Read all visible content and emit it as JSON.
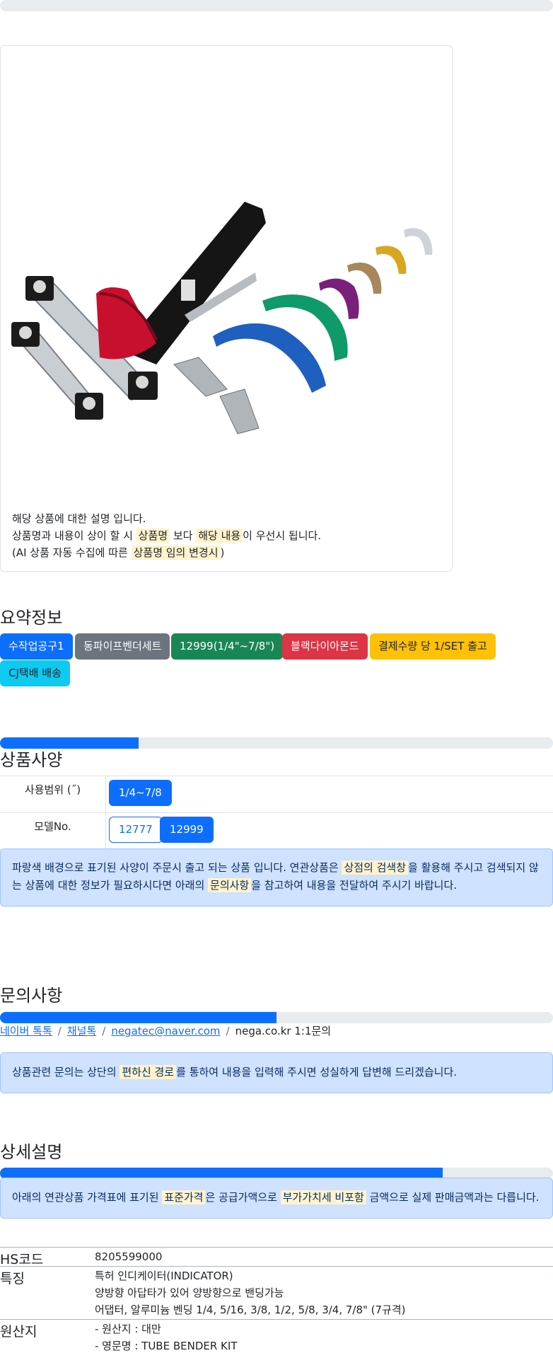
{
  "card": {
    "desc_line1": "해당 상품에 대한 설명 입니다.",
    "desc_line2_a": "상품명과 내용이 상이 할 시 ",
    "desc_line2_hl1": "상품명",
    "desc_line2_b": " 보다 ",
    "desc_line2_hl2": "해당 내용",
    "desc_line2_c": "이 우선시 됩니다.",
    "desc_line3_a": "(AI 상품 자동 수집에 따른 ",
    "desc_line3_hl": "상품명 임의 변경시",
    "desc_line3_b": ")"
  },
  "summary": {
    "title": "요약정보",
    "badges": [
      {
        "label": "수작업공구1",
        "color": "#0d6efd"
      },
      {
        "label": "동파이프벤더세트",
        "color": "#6c757d"
      },
      {
        "label": "12999(1/4\"~7/8\")",
        "color": "#198754"
      },
      {
        "label": "블랙다이아몬드",
        "color": "#dc3545"
      },
      {
        "label": "결제수량 당 1/SET 출고",
        "color": "#ffc107"
      },
      {
        "label": "CJ택배 배송",
        "color": "#0dcaf0"
      }
    ]
  },
  "specs": {
    "title": "상품사양",
    "progress": 0.25,
    "rows": [
      {
        "label": "사용범위 (˝)",
        "options": [
          {
            "label": "1/4~7/8",
            "selected": true
          }
        ]
      },
      {
        "label": "모델No.",
        "options": [
          {
            "label": "12777",
            "selected": false
          },
          {
            "label": "12999",
            "selected": true
          }
        ]
      }
    ],
    "notice_a": "파랑색 배경으로 표기된 사양이 주문시 출고 되는 상품 입니다. 연관상품은 ",
    "notice_hl1": "상점의 검색창",
    "notice_b": "을 활용해 주시고 검색되지 않는 상품에 대한 정보가 필요하시다면 아래의 ",
    "notice_hl2": "문의사항",
    "notice_c": "을 참고하여 내용을 전달하여 주시기 바랍니다."
  },
  "inquiry": {
    "title": "문의사항",
    "progress": 0.5,
    "links": [
      "네이버 톡톡",
      "채널톡",
      "negatec@naver.com"
    ],
    "tail": "nega.co.kr 1:1문의",
    "notice_a": "상품관련 문의는 상단의 ",
    "notice_hl": "편하신 경로",
    "notice_b": "를 통하여 내용을 입력해 주시면 성실하게 답변해 드리겠습니다."
  },
  "detail": {
    "title": "상세설명",
    "progress": 0.8,
    "notice_a": "아래의 연관상품 가격표에 표기된 ",
    "notice_hl1": "표준가격",
    "notice_b": "은 공급가액으로 ",
    "notice_hl2": "부가가치세 비포함",
    "notice_c": " 금액으로 실제 판매금액과는 다릅니다.",
    "rows": [
      {
        "label": "HS코드",
        "lines": [
          "8205599000"
        ]
      },
      {
        "label": "특징",
        "lines": [
          "특허 인디케이터(INDICATOR)",
          "양방향 아답타가 있어 양방향으로 밴딩가능",
          "어댑터, 알루미늄 벤딩 1/4, 5/16, 3/8, 1/2, 5/8, 3/4, 7/8\" (7규격)"
        ]
      },
      {
        "label": "원산지",
        "lines": [
          "- 원산지 : 대만",
          "- 영문명 : TUBE BENDER KIT"
        ]
      }
    ]
  }
}
